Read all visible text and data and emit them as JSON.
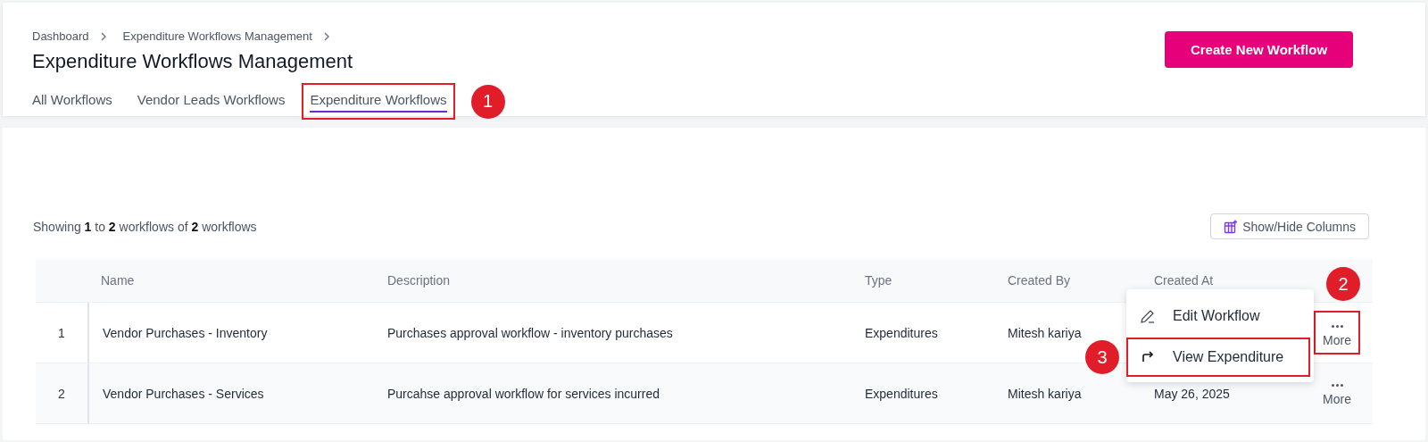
{
  "breadcrumb": [
    "Dashboard",
    "Expenditure Workflows Management"
  ],
  "title": "Expenditure Workflows Management",
  "create_button": "Create New Workflow",
  "tabs": [
    {
      "label": "All Workflows",
      "selected": false
    },
    {
      "label": "Vendor Leads Workflows",
      "selected": false
    },
    {
      "label": "Expenditure Workflows",
      "selected": true,
      "highlighted": true,
      "callout": "1"
    }
  ],
  "summary": "Showing **1** to **2** workflows of **2** workflows",
  "columns_button": "Show/Hide Columns",
  "table": {
    "columns": [
      "Name",
      "Description",
      "Type",
      "Created By",
      "Created At"
    ],
    "rows": [
      {
        "index": "1",
        "name": "Vendor Purchases - Inventory",
        "description": "Purchases approval workflow - inventory purchases",
        "type": "Expenditures",
        "created_by": "Mitesh kariya",
        "more": "More",
        "more_highlighted": true,
        "callout": "2"
      },
      {
        "index": "2",
        "name": "Vendor Purchases - Services",
        "description": "Purcahse approval workflow for services incurred",
        "type": "Expenditures",
        "created_by": "Mitesh kariya",
        "created_at": "May 26, 2025",
        "more": "More",
        "more_highlighted": false
      }
    ]
  },
  "menu": {
    "items": [
      {
        "kind": "edit",
        "label": "Edit Workflow",
        "highlighted": false
      },
      {
        "kind": "view",
        "label": "View Expenditure",
        "highlighted": true,
        "callout": "3"
      }
    ]
  }
}
